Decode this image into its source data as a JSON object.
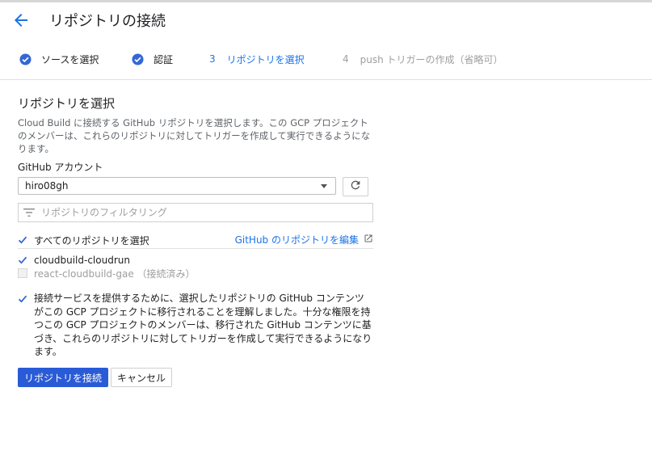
{
  "header": {
    "title": "リポジトリの接続"
  },
  "stepper": [
    {
      "status": "done",
      "label": "ソースを選択"
    },
    {
      "status": "done",
      "label": "認証"
    },
    {
      "status": "active",
      "number": "3",
      "label": "リポジトリを選択"
    },
    {
      "status": "inactive",
      "number": "4",
      "label": "push トリガーの作成（省略可）"
    }
  ],
  "section": {
    "title": "リポジトリを選択",
    "description": "Cloud Build に接続する GitHub リポジトリを選択します。この GCP プロジェクトのメンバーは、これらのリポジトリに対してトリガーを作成して実行できるようになります。"
  },
  "account": {
    "label": "GitHub アカウント",
    "selected": "hiro08gh"
  },
  "filter": {
    "placeholder": "リポジトリのフィルタリング"
  },
  "select_all": {
    "label": "すべてのリポジトリを選択",
    "checked": true
  },
  "edit_link": "GitHub のリポジトリを編集",
  "repos": [
    {
      "name": "cloudbuild-cloudrun",
      "checked": true,
      "disabled": false
    },
    {
      "name": "react-cloudbuild-gae （接続済み）",
      "checked": false,
      "disabled": true
    }
  ],
  "consent": {
    "checked": true,
    "text": "接続サービスを提供するために、選択したリポジトリの GitHub コンテンツがこの GCP プロジェクトに移行されることを理解しました。十分な権限を持つこの GCP プロジェクトのメンバーは、移行された GitHub コンテンツに基づき、これらのリポジトリに対してトリガーを作成して実行できるようになります。"
  },
  "buttons": {
    "connect": "リポジトリを接続",
    "cancel": "キャンセル"
  },
  "colors": {
    "accent": "#1a73e8",
    "primary_button": "#2a5bd7",
    "check_blue": "#3367d6"
  }
}
